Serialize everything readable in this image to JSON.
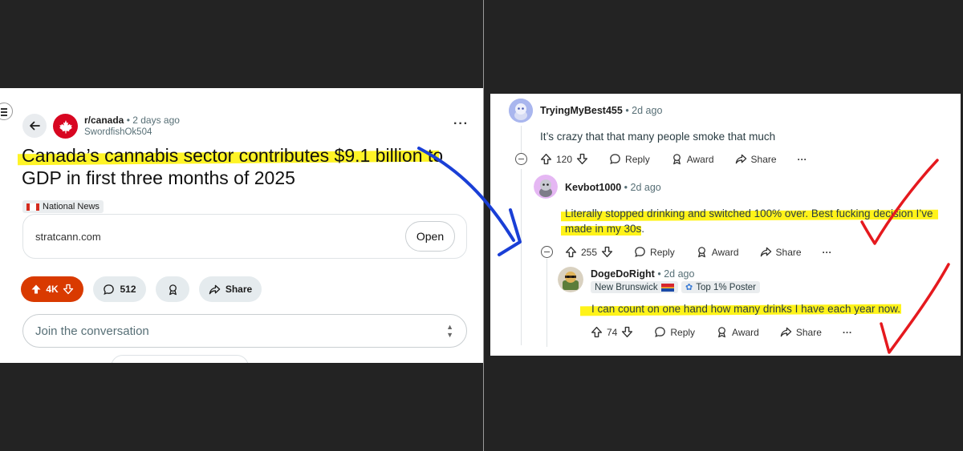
{
  "post": {
    "subreddit": "r/canada",
    "time_ago": "• 2 days ago",
    "author": "SwordfishOk504",
    "title": "Canada’s cannabis sector contributes $9.1 billion to GDP in first three months of 2025",
    "flair": "National News",
    "link_domain": "stratcann.com",
    "open_label": "Open",
    "upvotes": "4K",
    "comments_count": "512",
    "share_label": "Share",
    "join_placeholder": "Join the conversation"
  },
  "comments": [
    {
      "username": "TryingMyBest455",
      "time_ago": "• 2d ago",
      "body": "It’s crazy that that many people smoke that much",
      "votes": "120",
      "reply_label": "Reply",
      "award_label": "Award",
      "share_label": "Share",
      "more_label": "···"
    },
    {
      "username": "Kevbot1000",
      "time_ago": "• 2d ago",
      "body_line1": "Literally stopped drinking and switched 100% over. Best fucking decision I’ve",
      "body_line2": "made in my 30s.",
      "votes": "255",
      "reply_label": "Reply",
      "award_label": "Award",
      "share_label": "Share",
      "more_label": "···"
    },
    {
      "username": "DogeDoRight",
      "time_ago": "• 2d ago",
      "flair": "New Brunswick",
      "badge": "Top 1% Poster",
      "body": "I can count on one hand how many drinks I have each year now.",
      "votes": "74",
      "reply_label": "Reply",
      "award_label": "Award",
      "share_label": "Share",
      "more_label": "···"
    }
  ],
  "colors": {
    "upvote_active": "#d93a00",
    "highlight": "#fff200",
    "arrow_blue": "#1a3fd6",
    "checkmark_red": "#e5191e",
    "canada_red": "#d80621"
  },
  "icons": [
    "back-arrow-icon",
    "maple-leaf-icon",
    "more-icon",
    "upvote-icon",
    "downvote-icon",
    "comment-icon",
    "award-icon",
    "share-icon",
    "collapse-icon",
    "chevron-updown-icon"
  ]
}
